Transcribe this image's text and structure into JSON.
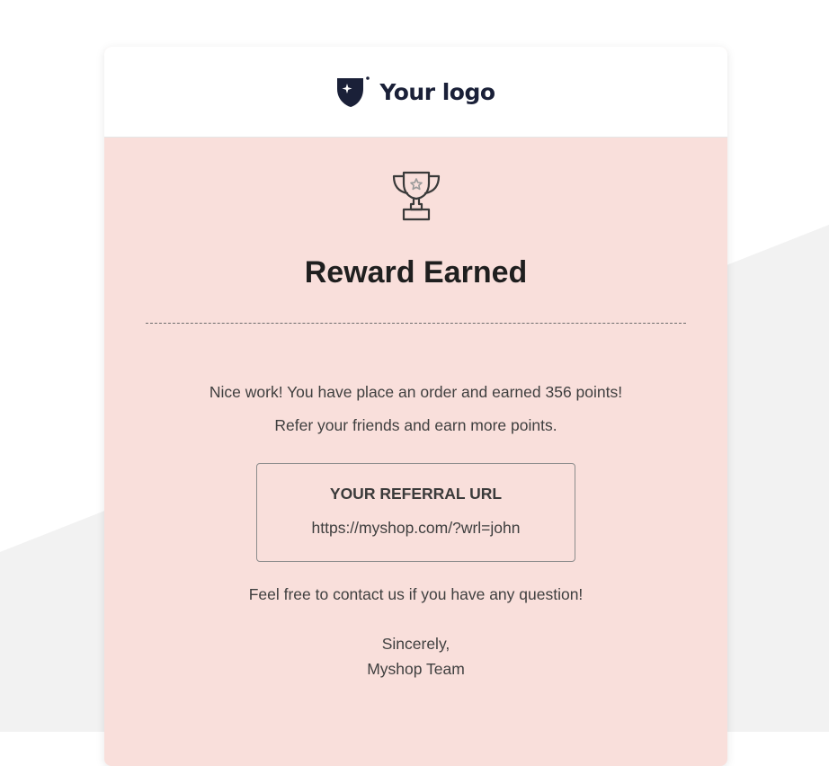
{
  "header": {
    "logo_text": "Your logo",
    "logo_icon": "shield-sparkle-icon"
  },
  "body": {
    "icon": "trophy-icon",
    "title": "Reward Earned",
    "message_line1": "Nice work! You have place an order and earned 356 points!",
    "message_line2": "Refer your friends and earn more points.",
    "referral": {
      "label": "YOUR REFERRAL URL",
      "url": "https://myshop.com/?wrl=john"
    },
    "contact_text": "Feel free to contact us if you have any question!",
    "signoff": "Sincerely,",
    "signature": "Myshop Team"
  },
  "colors": {
    "body_background": "#f9dfdb",
    "logo_color": "#1a2038",
    "page_shape": "#f2f2f2"
  }
}
